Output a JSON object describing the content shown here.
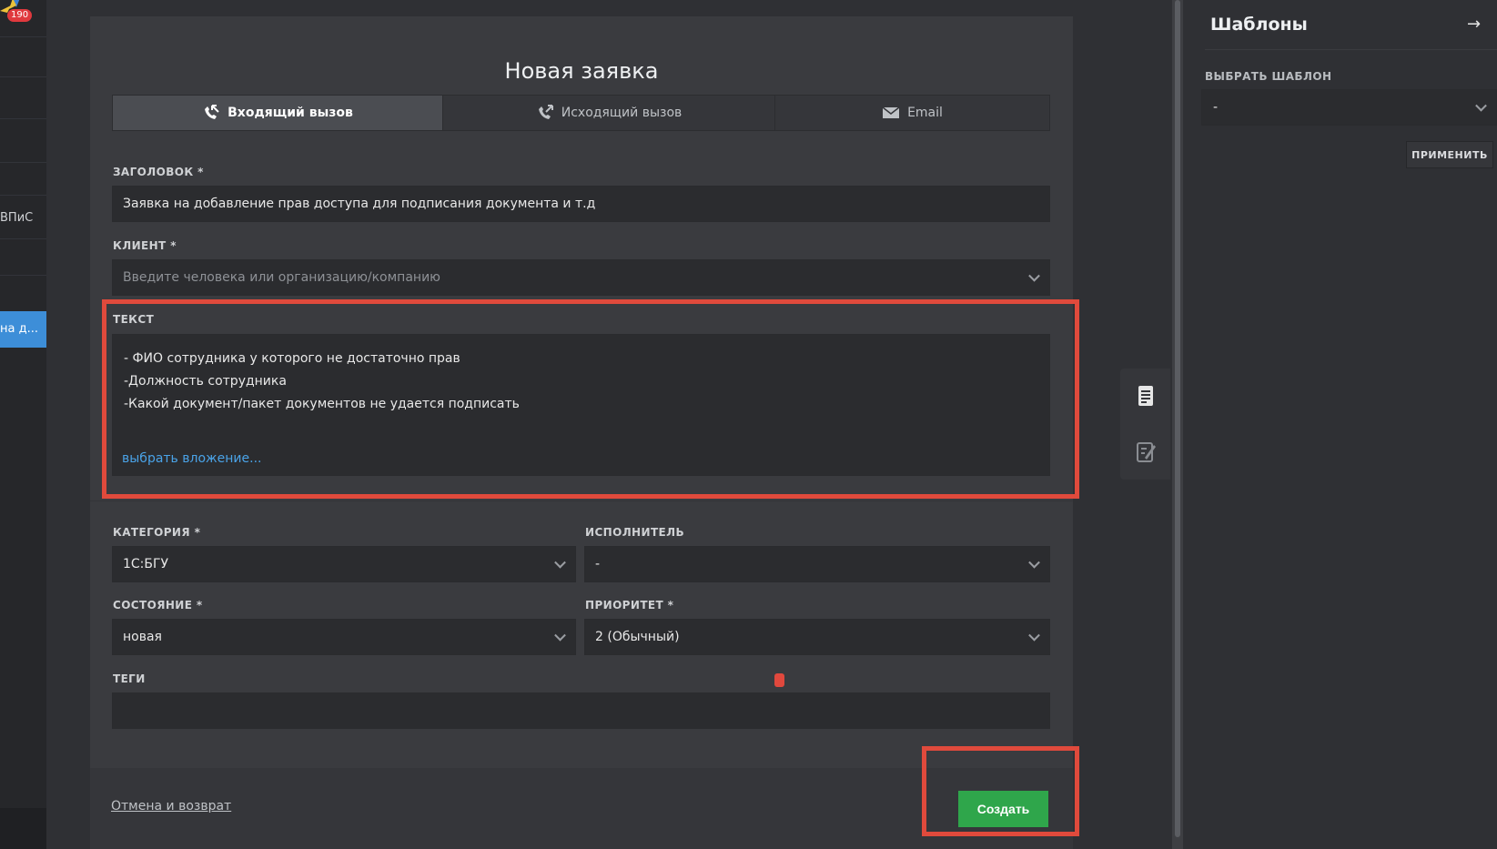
{
  "left_sidebar": {
    "badge_count": "190",
    "item_partial_label": "ВПиС",
    "active_item_label": "на д..."
  },
  "dialog": {
    "title": "Новая заявка",
    "tabs": [
      {
        "label": "Входящий вызов",
        "icon": "incoming-call-icon",
        "active": true
      },
      {
        "label": "Исходящий вызов",
        "icon": "outgoing-call-icon",
        "active": false
      },
      {
        "label": "Email",
        "icon": "email-icon",
        "active": false
      }
    ],
    "fields": {
      "title_label": "ЗАГОЛОВОК *",
      "title_value": "Заявка на добавление прав доступа для подписания документа и т.д",
      "client_label": "КЛИЕНТ *",
      "client_placeholder": "Введите человека или организацию/компанию",
      "text_label": "ТЕКСТ",
      "text_lines": [
        "- ФИО сотрудника у которого не достаточно прав",
        "-Должность сотрудника",
        "-Какой документ/пакет документов не удается подписать"
      ],
      "attach_link": "выбрать вложение...",
      "category_label": "КАТЕГОРИЯ *",
      "category_value": "1С:БГУ",
      "executor_label": "ИСПОЛНИТЕЛЬ",
      "executor_value": "-",
      "state_label": "СОСТОЯНИЕ *",
      "state_value": "новая",
      "priority_label": "ПРИОРИТЕТ *",
      "priority_value": "2 (Обычный)",
      "tags_label": "ТЕГИ",
      "tags_value": ""
    },
    "footer": {
      "cancel_label": "Отмена и возврат",
      "create_label": "Создать"
    }
  },
  "templates_panel": {
    "title": "Шаблоны",
    "select_label": "ВЫБРАТЬ ШАБЛОН",
    "select_value": "-",
    "apply_label": "ПРИМЕНИТЬ"
  },
  "colors": {
    "accent_blue": "#3d8ed8",
    "create_green": "#2fa64b",
    "annotation_red": "#e04a3c",
    "link_blue": "#4aa3e8"
  }
}
